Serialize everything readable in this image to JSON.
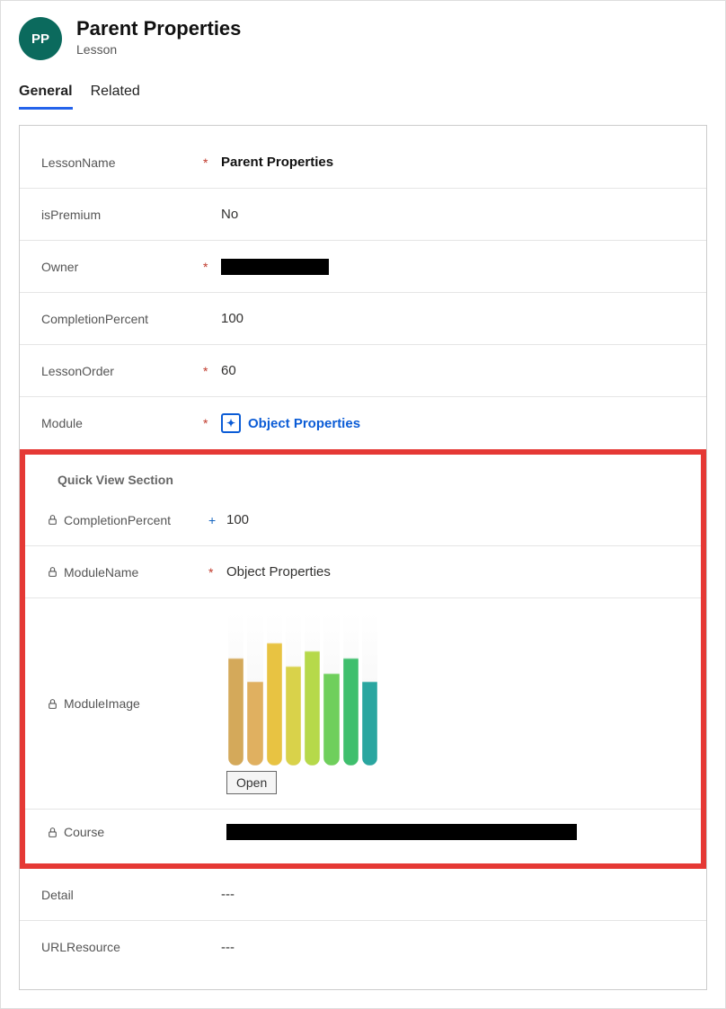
{
  "header": {
    "avatar_initials": "PP",
    "title": "Parent Properties",
    "subtitle": "Lesson"
  },
  "tabs": {
    "general": "General",
    "related": "Related"
  },
  "fields": {
    "lessonName": {
      "label": "LessonName",
      "value": "Parent Properties"
    },
    "isPremium": {
      "label": "isPremium",
      "value": "No"
    },
    "owner": {
      "label": "Owner"
    },
    "completionPercent": {
      "label": "CompletionPercent",
      "value": "100"
    },
    "lessonOrder": {
      "label": "LessonOrder",
      "value": "60"
    },
    "module": {
      "label": "Module",
      "value": "Object Properties"
    },
    "detail": {
      "label": "Detail",
      "value": "---"
    },
    "urlResource": {
      "label": "URLResource",
      "value": "---"
    }
  },
  "quickView": {
    "title": "Quick View Section",
    "completionPercent": {
      "label": "CompletionPercent",
      "value": "100"
    },
    "moduleName": {
      "label": "ModuleName",
      "value": "Object Properties"
    },
    "moduleImage": {
      "label": "ModuleImage",
      "open_label": "Open"
    },
    "course": {
      "label": "Course"
    }
  },
  "required_marker": "*"
}
